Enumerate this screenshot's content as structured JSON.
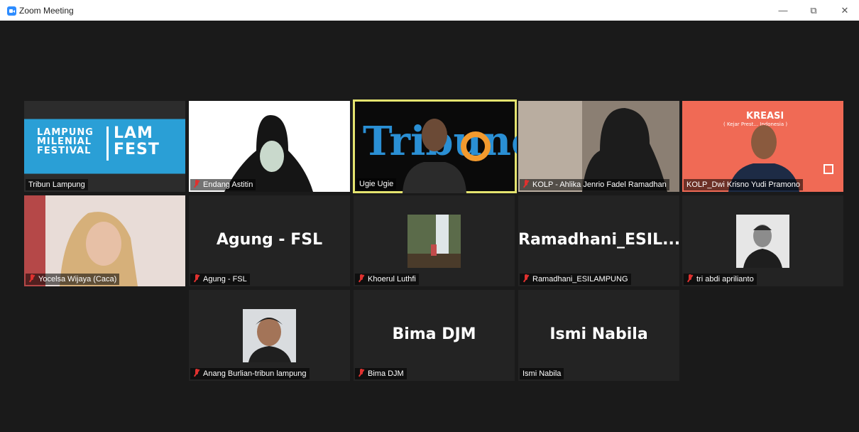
{
  "window": {
    "title": "Zoom Meeting",
    "controls": {
      "minimize": "—",
      "restore": "⧉",
      "close": "✕"
    }
  },
  "colors": {
    "active_speaker_border": "#e4e36f",
    "muted_mic": "#e0312f",
    "tile_bg": "#232323"
  },
  "tiles": [
    {
      "name": "Tribun Lampung",
      "muted": false,
      "type": "video",
      "logo_lines": [
        "LAMPUNG",
        "MILENIAL",
        "FESTIVAL"
      ],
      "logo_mark": [
        "LAM",
        "FEST"
      ]
    },
    {
      "name": "Endang Astitin",
      "muted": true,
      "type": "video"
    },
    {
      "name": "Ugie Ugie",
      "muted": false,
      "type": "video",
      "active": true,
      "background_text": "Tribuneo"
    },
    {
      "name": "KOLP - Ahlika Jenrio Fadel Ramadhan",
      "muted": true,
      "type": "video"
    },
    {
      "name": "KOLP_Dwi Krisno Yudi Pramono",
      "muted": false,
      "type": "video",
      "background_text": "KREASI",
      "background_sub": "( Kejar Prest... Indonesia )"
    },
    {
      "name": "Yocelsa Wijaya (Caca)",
      "muted": true,
      "type": "video"
    },
    {
      "name": "Agung - FSL",
      "muted": true,
      "type": "text",
      "display": "Agung - FSL"
    },
    {
      "name": "Khoerul Luthfi",
      "muted": true,
      "type": "avatar"
    },
    {
      "name": "Ramadhani_ESILAMPUNG",
      "muted": true,
      "type": "text",
      "display": "Ramadhani_ESIL..."
    },
    {
      "name": "tri abdi aprilianto",
      "muted": true,
      "type": "avatar"
    },
    {
      "name": "Anang Burlian-tribun lampung",
      "muted": true,
      "type": "avatar"
    },
    {
      "name": "Bima DJM",
      "muted": true,
      "type": "text",
      "display": "Bima DJM"
    },
    {
      "name": "Ismi Nabila",
      "muted": false,
      "type": "text",
      "display": "Ismi Nabila"
    }
  ]
}
